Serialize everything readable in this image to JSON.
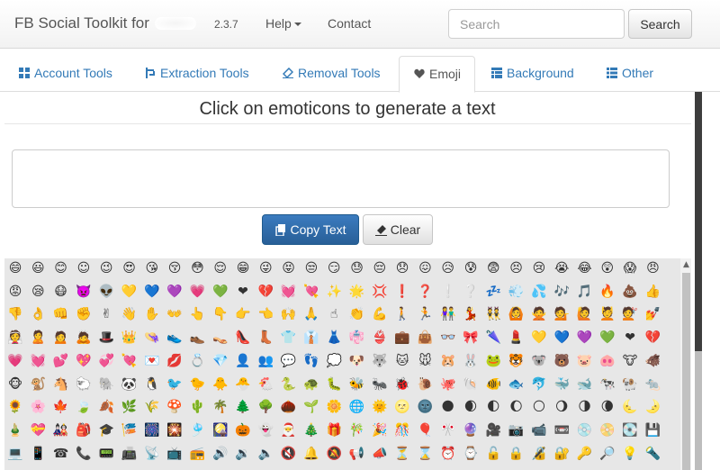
{
  "navbar": {
    "brand": "FB Social Toolkit for",
    "version": "2.3.7",
    "help_label": "Help",
    "contact_label": "Contact",
    "search_placeholder": "Search",
    "search_button": "Search"
  },
  "tabs": [
    {
      "label": "Account Tools",
      "icon": "grid-icon"
    },
    {
      "label": "Extraction Tools",
      "icon": "extract-icon"
    },
    {
      "label": "Removal Tools",
      "icon": "eraser-icon"
    },
    {
      "label": "Emoji",
      "icon": "heart-icon",
      "active": true
    },
    {
      "label": "Background",
      "icon": "table-icon"
    },
    {
      "label": "Other",
      "icon": "list-icon"
    }
  ],
  "main": {
    "heading": "Click on emoticons to generate a text",
    "copy_button": "Copy Text",
    "clear_button": "Clear"
  },
  "colors": {
    "link": "#337ab7",
    "primary": "#2d6ca8",
    "emoji_panel_bg": "#e7e7e7"
  },
  "emoji_rows": [
    [
      "😄",
      "😃",
      "😊",
      "☺",
      "😉",
      "😍",
      "😘",
      "😚",
      "😳",
      "😌",
      "😁",
      "😜",
      "😝",
      "😒",
      "😏",
      "😓",
      "😔",
      "😞",
      "😖",
      "😥",
      "😰",
      "😨",
      "😣",
      "😢",
      "😭",
      "😂",
      "😲",
      "😱",
      "😠"
    ],
    [
      "😡",
      "😪",
      "😷",
      "👿",
      "👽",
      "💛",
      "💙",
      "💜",
      "💗",
      "💚",
      "❤",
      "💔",
      "💓",
      "💘",
      "✨",
      "🌟",
      "💢",
      "❗",
      "❓",
      "❕",
      "❔",
      "💤",
      "💨",
      "💦",
      "🎶",
      "🎵",
      "🔥",
      "💩",
      "👍"
    ],
    [
      "👎",
      "👌",
      "👊",
      "✊",
      "✌",
      "👋",
      "✋",
      "👐",
      "👆",
      "👇",
      "👉",
      "👈",
      "🙌",
      "🙏",
      "☝",
      "👏",
      "💪",
      "🚶",
      "🏃",
      "👫",
      "💃",
      "👯",
      "🙆",
      "🙅",
      "💁",
      "🙋",
      "💆",
      "💇",
      "💅"
    ],
    [
      "👰",
      "🙎",
      "🙍",
      "🙇",
      "🎩",
      "👑",
      "👒",
      "👟",
      "👞",
      "👡",
      "👠",
      "👢",
      "👕",
      "👔",
      "👗",
      "👘",
      "👙",
      "💼",
      "👜",
      "👓",
      "🎀",
      "🌂",
      "💄",
      "💛",
      "💙",
      "💜",
      "💚",
      "❤",
      "💔"
    ],
    [
      "💗",
      "💓",
      "💕",
      "💖",
      "💞",
      "💘",
      "💌",
      "💋",
      "💍",
      "💎",
      "👤",
      "👥",
      "💬",
      "👣",
      "💭",
      "🐶",
      "🐺",
      "🐱",
      "🐭",
      "🐹",
      "🐰",
      "🐸",
      "🐯",
      "🐨",
      "🐻",
      "🐷",
      "🐽",
      "🐮",
      "🐗"
    ],
    [
      "🐵",
      "🐒",
      "🐴",
      "🐑",
      "🐘",
      "🐼",
      "🐧",
      "🐦",
      "🐤",
      "🐥",
      "🐣",
      "🐔",
      "🐍",
      "🐢",
      "🐛",
      "🐝",
      "🐜",
      "🐞",
      "🐌",
      "🐙",
      "🐚",
      "🐠",
      "🐟",
      "🐬",
      "🐳",
      "🐋",
      "🐄",
      "🐏",
      "🐀"
    ],
    [
      "🌻",
      "🌸",
      "🍁",
      "🍃",
      "🍂",
      "🌿",
      "🌾",
      "🍄",
      "🌵",
      "🌴",
      "🌲",
      "🌳",
      "🌰",
      "🌱",
      "🌼",
      "🌐",
      "🌞",
      "🌝",
      "🌚",
      "🌑",
      "🌒",
      "🌓",
      "🌔",
      "🌕",
      "🌖",
      "🌗",
      "🌘",
      "🌜",
      "🌛"
    ],
    [
      "🎍",
      "💝",
      "🎎",
      "🎒",
      "🎓",
      "🎏",
      "🎆",
      "🎇",
      "🎐",
      "🎑",
      "🎃",
      "👻",
      "🎅",
      "🎄",
      "🎁",
      "🎋",
      "🎉",
      "🎊",
      "🎈",
      "🎌",
      "🔮",
      "🎥",
      "📷",
      "📹",
      "📼",
      "💿",
      "📀",
      "💽",
      "💾"
    ],
    [
      "💻",
      "📱",
      "☎",
      "📞",
      "📟",
      "📠",
      "📡",
      "📺",
      "📻",
      "🔊",
      "🔉",
      "🔈",
      "🔇",
      "🔔",
      "🔕",
      "📢",
      "📣",
      "⏳",
      "⌛",
      "⏰",
      "⌚",
      "🔓",
      "🔒",
      "🔏",
      "🔐",
      "🔑",
      "🔎",
      "💡",
      "🔦"
    ]
  ]
}
